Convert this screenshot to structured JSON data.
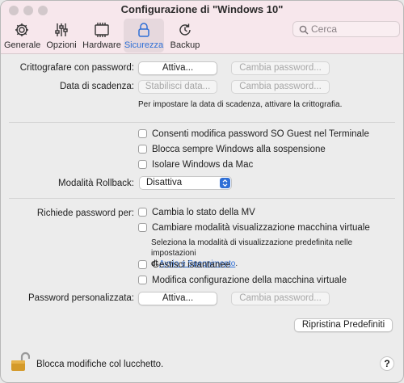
{
  "window": {
    "title": "Configurazione di \"Windows 10\""
  },
  "search": {
    "placeholder": "Cerca"
  },
  "tabs": [
    {
      "label": "Generale",
      "icon": "gear-icon"
    },
    {
      "label": "Opzioni",
      "icon": "sliders-icon"
    },
    {
      "label": "Hardware",
      "icon": "chip-icon"
    },
    {
      "label": "Sicurezza",
      "icon": "lock-icon",
      "active": true
    },
    {
      "label": "Backup",
      "icon": "backup-icon"
    }
  ],
  "encryption": {
    "label": "Crittografare con password:",
    "activate": "Attiva...",
    "change_password": "Cambia password..."
  },
  "expiration": {
    "label": "Data di scadenza:",
    "set_date": "Stabilisci data...",
    "change_password": "Cambia password...",
    "note": "Per impostare la data di scadenza, attivare la crittografia."
  },
  "checkboxes_top": [
    "Consenti modifica password SO Guest nel Terminale",
    "Blocca sempre Windows alla sospensione",
    "Isolare Windows da Mac"
  ],
  "rollback": {
    "label": "Modalità Rollback:",
    "value": "Disattiva"
  },
  "require_password": {
    "label": "Richiede password per:",
    "items": [
      "Cambia lo stato della MV",
      "Cambiare modalità visualizzazione macchina virtuale"
    ],
    "note_line1": "Seleziona la modalità di visualizzazione predefinita nelle impostazioni",
    "note_prefix": "di ",
    "note_link": "Avvio e Spegnimento",
    "note_suffix": ".",
    "items_more": [
      "Gestisci istantanee",
      "Modifica configurazione della macchina virtuale"
    ]
  },
  "custom_password": {
    "label": "Password personalizzata:",
    "activate": "Attiva...",
    "change_password": "Cambia password..."
  },
  "restore_defaults": "Ripristina Predefiniti",
  "lock": {
    "text": "Blocca modifiche col lucchetto."
  },
  "help": "?",
  "colors": {
    "accent": "#2f6fd6",
    "titlebar": "#f7e7ec"
  }
}
